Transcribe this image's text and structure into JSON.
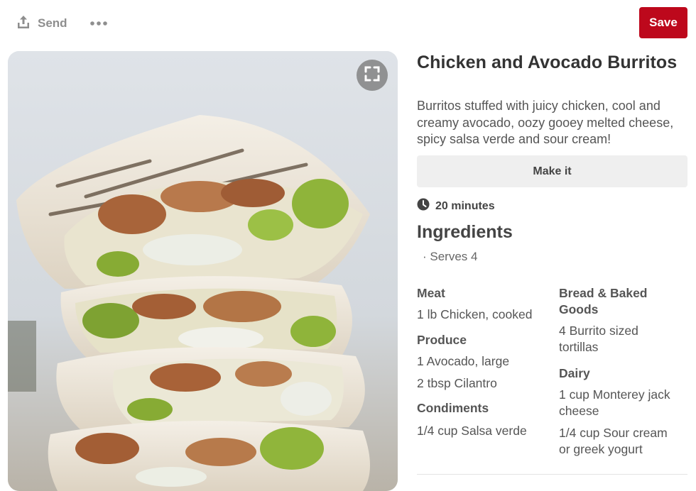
{
  "toolbar": {
    "send_label": "Send",
    "save_label": "Save",
    "save_color": "#bd081c",
    "icons": {
      "send": "share-upload-icon",
      "more": "ellipsis-icon",
      "zoom": "expand-frame-icon"
    }
  },
  "pin": {
    "title": "Chicken and Avocado Burritos",
    "description": "Burritos stuffed with juicy chicken, cool and creamy avocado, oozy gooey melted cheese, spicy salsa verde and sour cream!",
    "make_it_label": "Make it",
    "time": "20 minutes",
    "time_icon": "clock-icon"
  },
  "ingredients": {
    "title": "Ingredients",
    "serves": "· Serves 4",
    "categories": [
      {
        "name": "Meat",
        "items": [
          "1 lb Chicken, cooked"
        ]
      },
      {
        "name": "Produce",
        "items": [
          "1 Avocado, large",
          "2 tbsp Cilantro"
        ]
      },
      {
        "name": "Condiments",
        "items": [
          "1/4 cup Salsa verde"
        ]
      },
      {
        "name_lines": [
          "Bread & Baked",
          "Goods"
        ],
        "items": [
          [
            "4 Burrito sized",
            "tortillas"
          ]
        ]
      },
      {
        "name": "Dairy",
        "items": [
          [
            "1 cup Monterey jack",
            "cheese"
          ],
          [
            "1/4 cup Sour cream",
            "or greek yogurt"
          ]
        ]
      }
    ]
  }
}
